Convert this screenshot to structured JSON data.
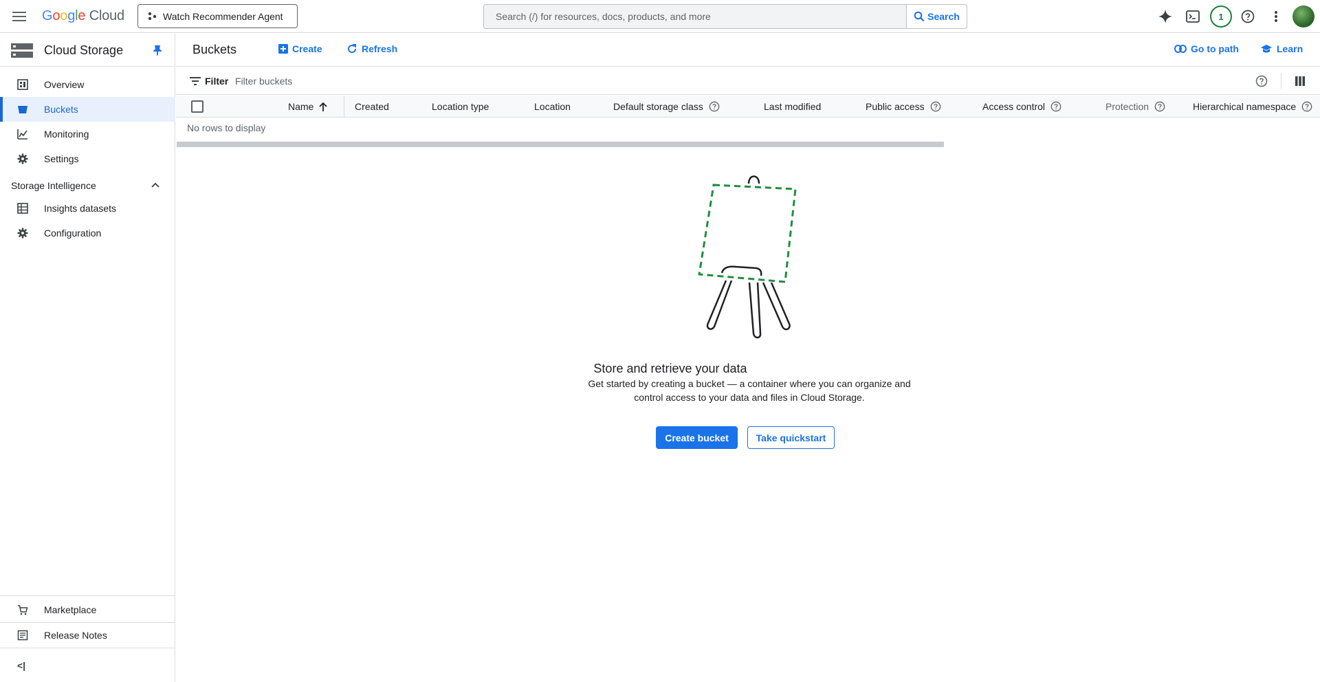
{
  "topbar": {
    "logo": {
      "g": "G",
      "o1": "o",
      "o2": "o",
      "g2": "g",
      "l": "l",
      "e": "e",
      "cloud": "Cloud"
    },
    "agent_button": "Watch Recommender Agent",
    "search_placeholder": "Search (/) for resources, docs, products, and more",
    "search_button": "Search",
    "notification_count": "1"
  },
  "sidebar": {
    "product_title": "Cloud Storage",
    "items": [
      {
        "label": "Overview"
      },
      {
        "label": "Buckets"
      },
      {
        "label": "Monitoring"
      },
      {
        "label": "Settings"
      }
    ],
    "section": {
      "label": "Storage Intelligence",
      "items": [
        {
          "label": "Insights datasets"
        },
        {
          "label": "Configuration"
        }
      ]
    },
    "footer": [
      {
        "label": "Marketplace"
      },
      {
        "label": "Release Notes"
      }
    ],
    "collapse_glyph": "<|"
  },
  "header": {
    "title": "Buckets",
    "create": "Create",
    "refresh": "Refresh",
    "go_to_path": "Go to path",
    "learn": "Learn"
  },
  "filter": {
    "label": "Filter",
    "placeholder": "Filter buckets"
  },
  "table": {
    "columns": [
      {
        "label": "Name"
      },
      {
        "label": "Created"
      },
      {
        "label": "Location type"
      },
      {
        "label": "Location"
      },
      {
        "label": "Default storage class"
      },
      {
        "label": "Last modified"
      },
      {
        "label": "Public access"
      },
      {
        "label": "Access control"
      },
      {
        "label": "Protection"
      },
      {
        "label": "Hierarchical namespace"
      }
    ],
    "empty_text": "No rows to display"
  },
  "empty_state": {
    "title": "Store and retrieve your data",
    "description": "Get started by creating a bucket — a container where you can organize and control access to your data and files in Cloud Storage.",
    "primary_button": "Create bucket",
    "secondary_button": "Take quickstart"
  },
  "colors": {
    "accent": "#1a73e8",
    "active_nav_bg": "#e8f0fe",
    "notification": "#188038",
    "illustration_dash": "#1e8e3e"
  }
}
